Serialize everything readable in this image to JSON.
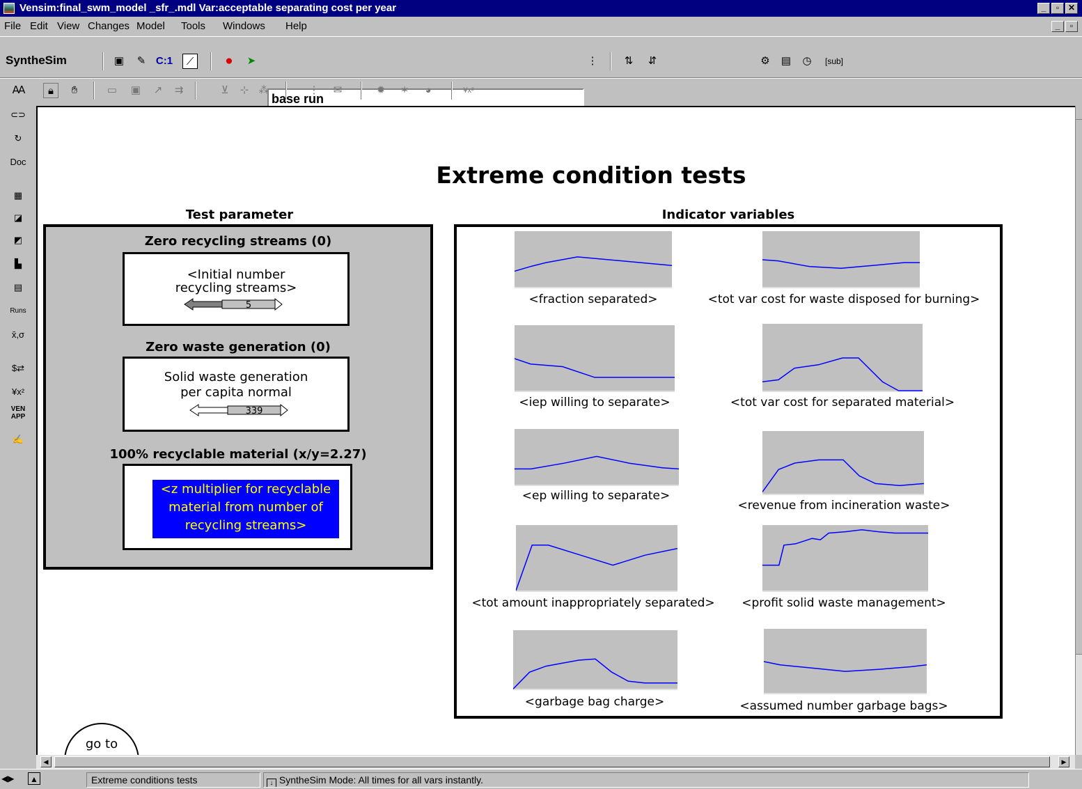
{
  "window": {
    "title": "Vensim:final_swm_model _sfr_.mdl Var:acceptable separating cost per year"
  },
  "menu": [
    "File",
    "Edit",
    "View",
    "Changes",
    "Model",
    "Tools",
    "Windows",
    "Help"
  ],
  "toolbar": {
    "mode_label": "SyntheSim",
    "run_name": "base run",
    "tool_c1": "C:1",
    "tool_sub": "[sub]"
  },
  "toolbox": {
    "doc_label": "Doc",
    "runs_label": "Runs",
    "stats_label": "x̄,σ",
    "ven_label": "VEN",
    "app_label": "APP"
  },
  "diagram": {
    "title": "Extreme condition tests",
    "test_parameter_header": "Test parameter",
    "indicator_header": "Indicator variables",
    "tests": [
      {
        "title": "Zero recycling streams (0)",
        "label_line1": "<Initial number",
        "label_line2": "recycling streams>",
        "slider_value": "5"
      },
      {
        "title": "Zero waste generation (0)",
        "label_line1": "Solid waste generation",
        "label_line2": "per capita normal",
        "slider_value": "339"
      },
      {
        "title": "100% recyclable material (x/y=2.27)",
        "label_line1": "<z multiplier for recyclable",
        "label_line2": "material from number of",
        "label_line3": "recycling streams>"
      }
    ],
    "indicators": [
      "<fraction separated>",
      "<tot var cost for waste disposed for burning>",
      "<iep willing to separate>",
      "<tot var cost for separated material>",
      "<ep willing to separate>",
      "<revenue from incineration waste>",
      "<tot amount inappropriately separated>",
      "<profit solid waste management>",
      "<garbage bag charge>",
      "<assumed number garbage bags>"
    ],
    "goto_label": "go to"
  },
  "status": {
    "view_name": "Extreme conditions tests",
    "mode_text": "SyntheSim Mode: All times for all vars instantly."
  },
  "colors": {
    "title_bar": "#000080",
    "graph_bg": "#c0c0c0",
    "graph_line": "#0000ff",
    "highlight_bg": "#0000ff",
    "highlight_text": "#ffff00"
  }
}
